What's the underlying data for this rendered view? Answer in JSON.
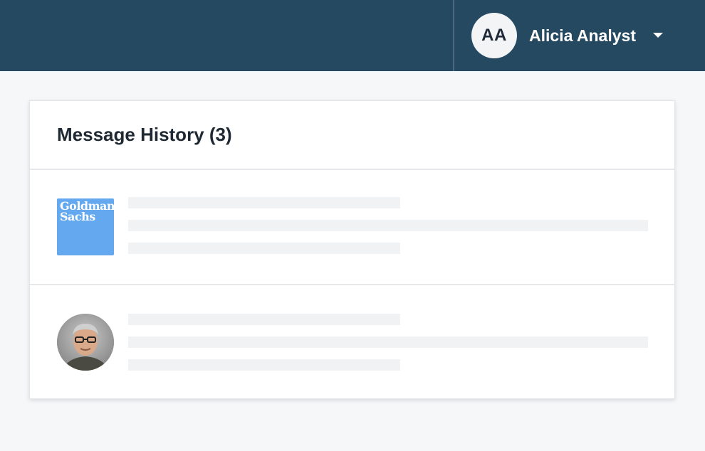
{
  "header": {
    "user": {
      "initials": "AA",
      "name": "Alicia Analyst"
    }
  },
  "card": {
    "title": "Message History (3)",
    "messages": [
      {
        "sender_logo_text": [
          "Goldman",
          "Sachs"
        ],
        "avatar_type": "company-logo"
      },
      {
        "avatar_type": "person-photo"
      }
    ]
  },
  "colors": {
    "topbar": "#244961",
    "logo_blue": "#64a8f0",
    "skeleton": "#f1f2f3"
  }
}
